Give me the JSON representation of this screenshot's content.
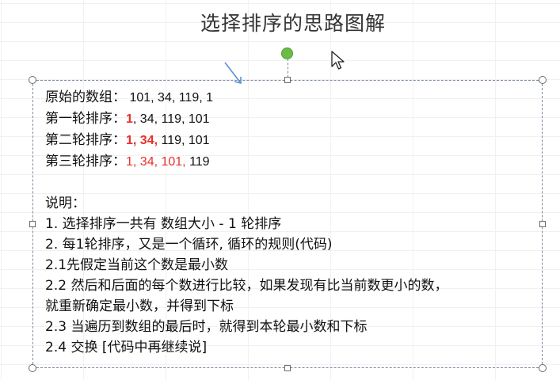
{
  "title": "选择排序的思路图解",
  "rows": [
    {
      "label": "原始的数组：",
      "parts": [
        {
          "text": " 101, 34, 119, 1",
          "style": "plain"
        }
      ]
    },
    {
      "label": "第一轮排序：",
      "parts": [
        {
          "text": "1",
          "style": "red-bold"
        },
        {
          "text": ", 34, 119, 101",
          "style": "plain"
        }
      ]
    },
    {
      "label": "第二轮排序：",
      "parts": [
        {
          "text": "1, 34,",
          "style": "red-bold"
        },
        {
          "text": " 119, 101",
          "style": "plain"
        }
      ]
    },
    {
      "label": "第三轮排序：",
      "parts": [
        {
          "text": "1, 34, 101,",
          "style": "red"
        },
        {
          "text": " 119",
          "style": "plain"
        }
      ]
    }
  ],
  "notes_heading": "说明：",
  "notes": [
    "1. 选择排序一共有 数组大小 - 1 轮排序",
    "2. 每1轮排序，又是一个循环, 循环的规则(代码)",
    "2.1先假定当前这个数是最小数",
    "2.2 然后和后面的每个数进行比较，如果发现有比当前数更小的数，",
    "就重新确定最小数，并得到下标",
    "2.3 当遍历到数组的最后时，就得到本轮最小数和下标",
    "2.4 交换 [代码中再继续说]"
  ],
  "colors": {
    "highlight": "#e8302a",
    "rotate_handle": "#6cbd45",
    "selection_border": "#7a8aa0"
  },
  "icons": [
    "mouse-pointer-icon",
    "annotation-arrow-icon",
    "rotate-handle-icon"
  ]
}
